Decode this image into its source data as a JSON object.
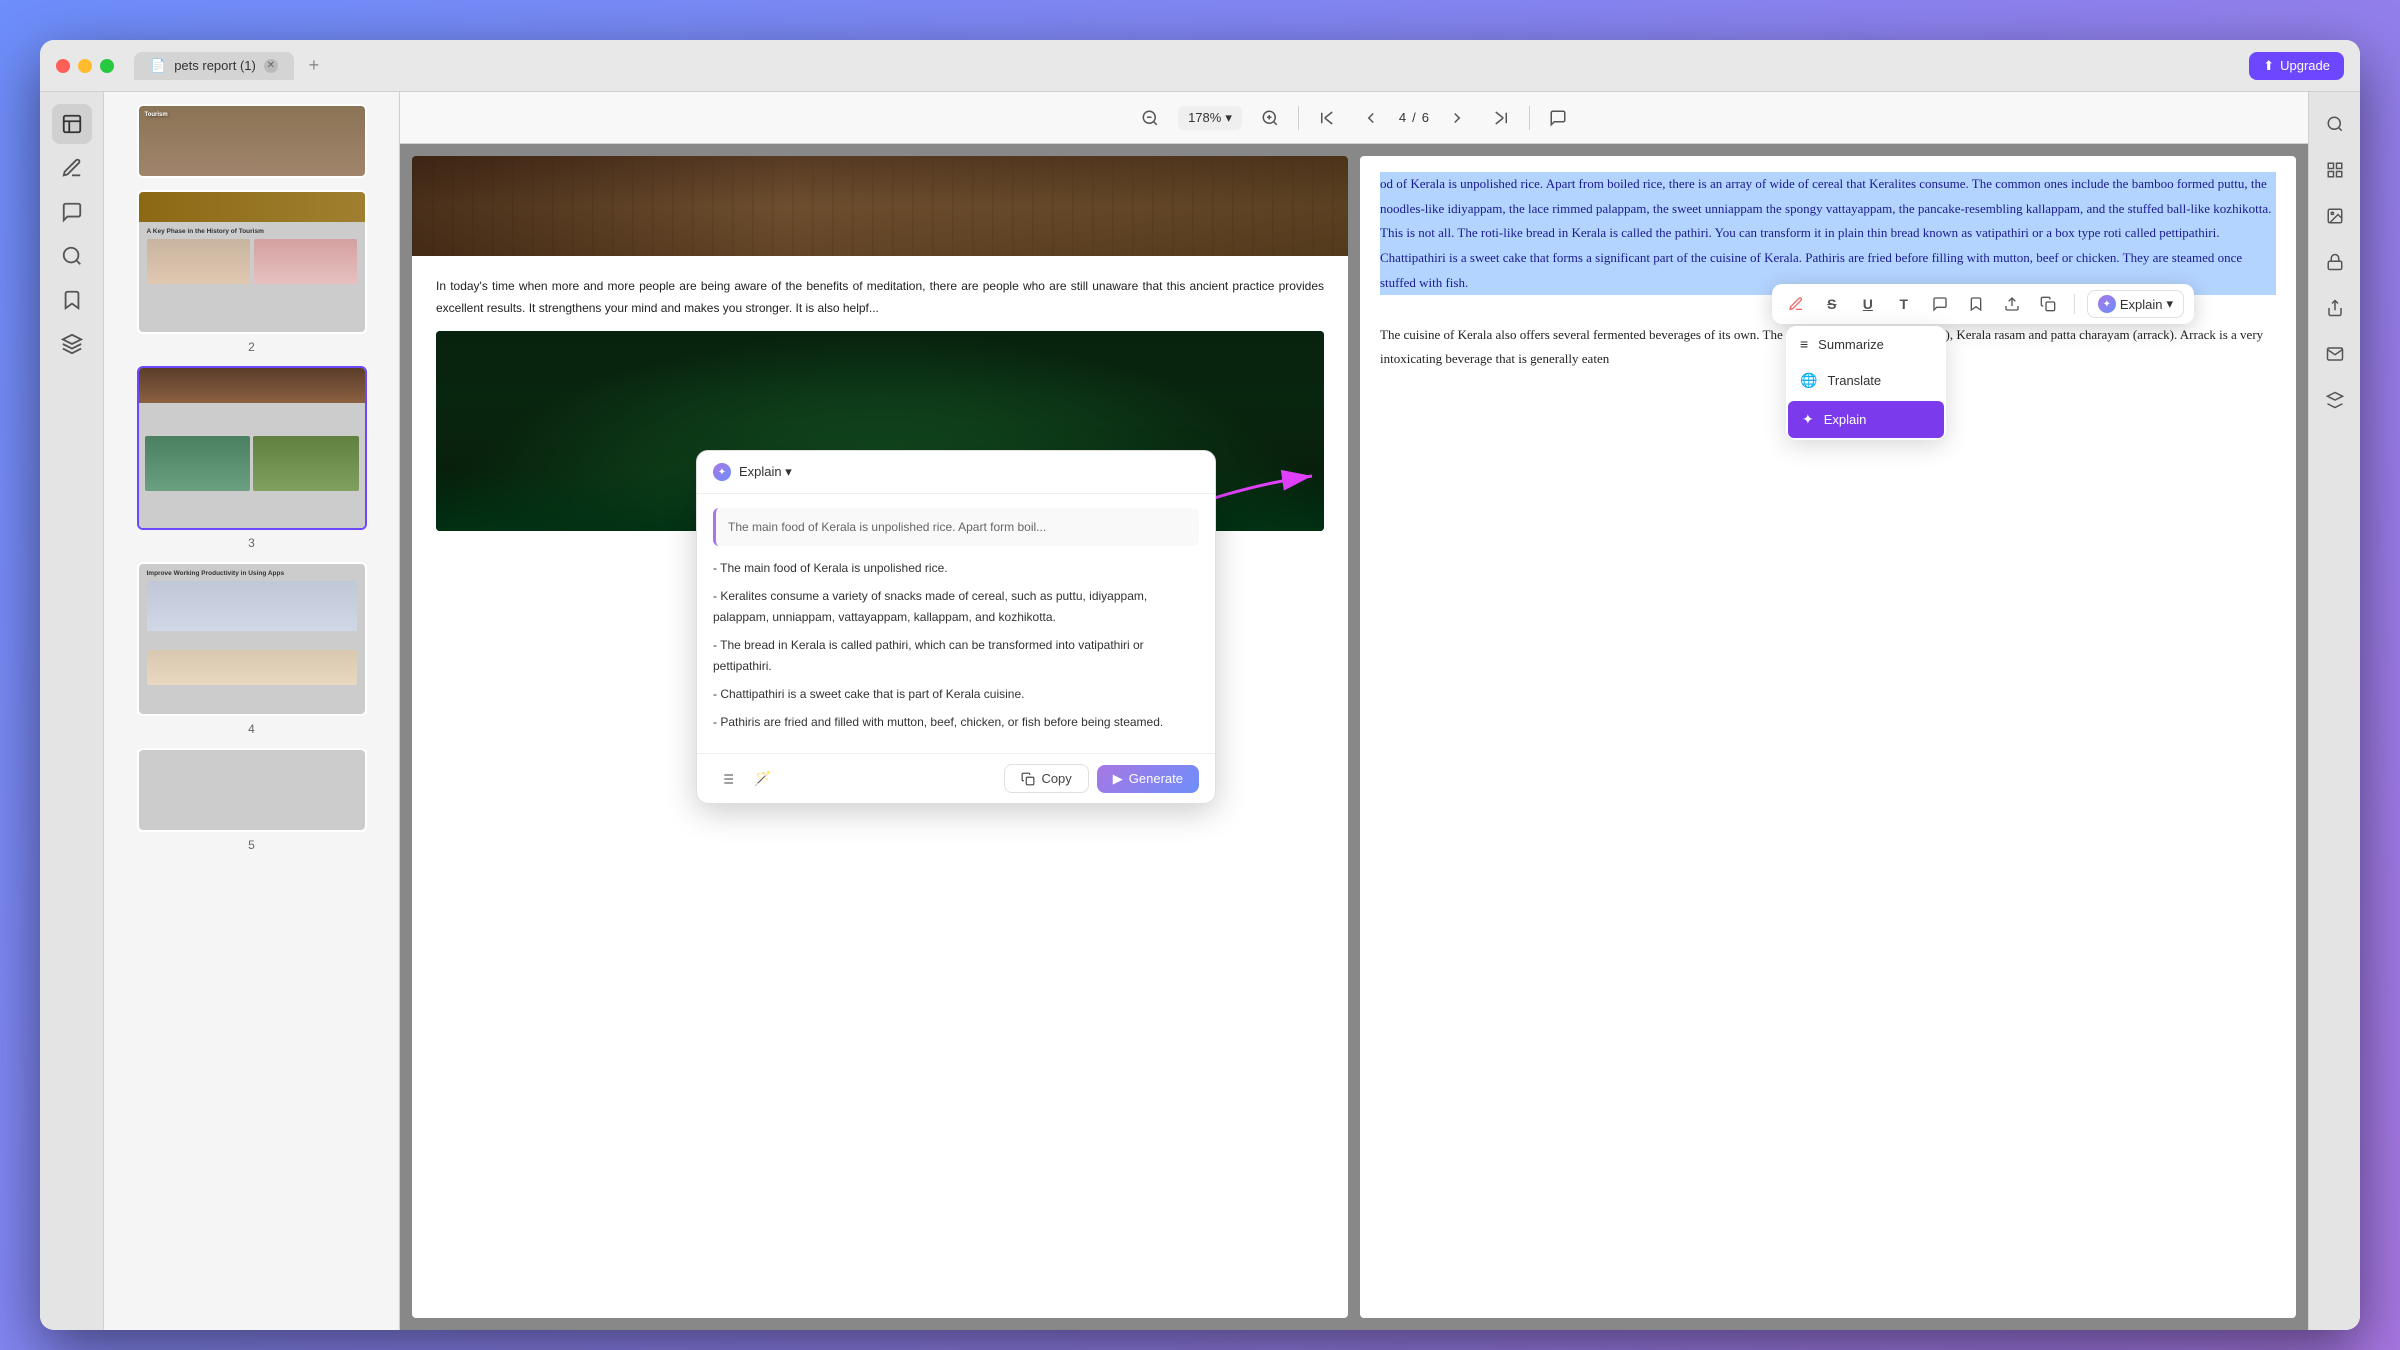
{
  "window": {
    "title": "pets report (1)",
    "upgrade_label": "Upgrade"
  },
  "toolbar": {
    "zoom": "178%",
    "page_current": "4",
    "page_total": "6"
  },
  "thumbnails": [
    {
      "id": 2,
      "label": "2",
      "title": "A Key Phase in the History of Tourism"
    },
    {
      "id": 3,
      "label": "3",
      "active": true
    },
    {
      "id": 4,
      "label": "4",
      "title": "Improve Working Productivity in Using Apps"
    },
    {
      "id": 5,
      "label": "5"
    }
  ],
  "page": {
    "left_text": "In today's time when more and more people are being aware of the benefits of meditation, there are people who are still unaware that this ancient practice provides excellent results. It strengthens your mind and makes you stronger. It is also helpf...",
    "right_text_highlighted": "od of Kerala is unpolished rice. Apart from boiled rice, there is an array of wide of cereal that Keralites consume. The common ones include the bamboo formed puttu, the noodles-like idiyappam, the lace rimmed palappam, the sweet unniappam the spongy vattayappam, the pancake-resembling kallappam, and the stuffed ball-like kozhikotta. This is not all. The roti-like bread in Kerala is called the pathiri. You can transform it in plain thin bread known as vatipathiri or a box type roti called pettipathiri. Chattipathiri is a sweet cake that forms a significant part of the cuisine of Kerala. Pathiris are fried before filling with mutton, beef or chicken. They are steamed once stuffed with fish.",
    "right_text_normal": "The cuisine of Kerala also offers several fermented beverages of its own. The famous drinks are kallu (toddy), Kerala rasam and patta charayam (arrack). Arrack is a very intoxicating beverage that is generally eaten"
  },
  "selection_toolbar": {
    "explain_label": "Explain",
    "explain_caret": "▾",
    "summarize_label": "Summarize",
    "translate_label": "Translate",
    "explain_active": "Explain"
  },
  "explain_panel": {
    "title": "Explain",
    "quote": "The main food of Kerala is unpolished rice. Apart form boil...",
    "results": [
      "- The main food of Kerala is unpolished rice.",
      "- Keralites consume a variety of snacks made of cereal, such as puttu, idiyappam, palappam, unniappam, vattayappam, kallappam, and kozhikotta.",
      "- The bread in Kerala is called pathiri, which can be transformed into vatipathiri or pettipathiri.",
      "- Chattipathiri is a sweet cake that is part of Kerala cuisine.",
      "- Pathiris are fried and filled with mutton, beef, chicken, or fish before being steamed."
    ],
    "copy_label": "Copy",
    "generate_label": "Generate"
  },
  "detected": {
    "key_phase": "Key Phase in the History of Tourism",
    "arrack": "Arrack",
    "copy": "Copy"
  }
}
